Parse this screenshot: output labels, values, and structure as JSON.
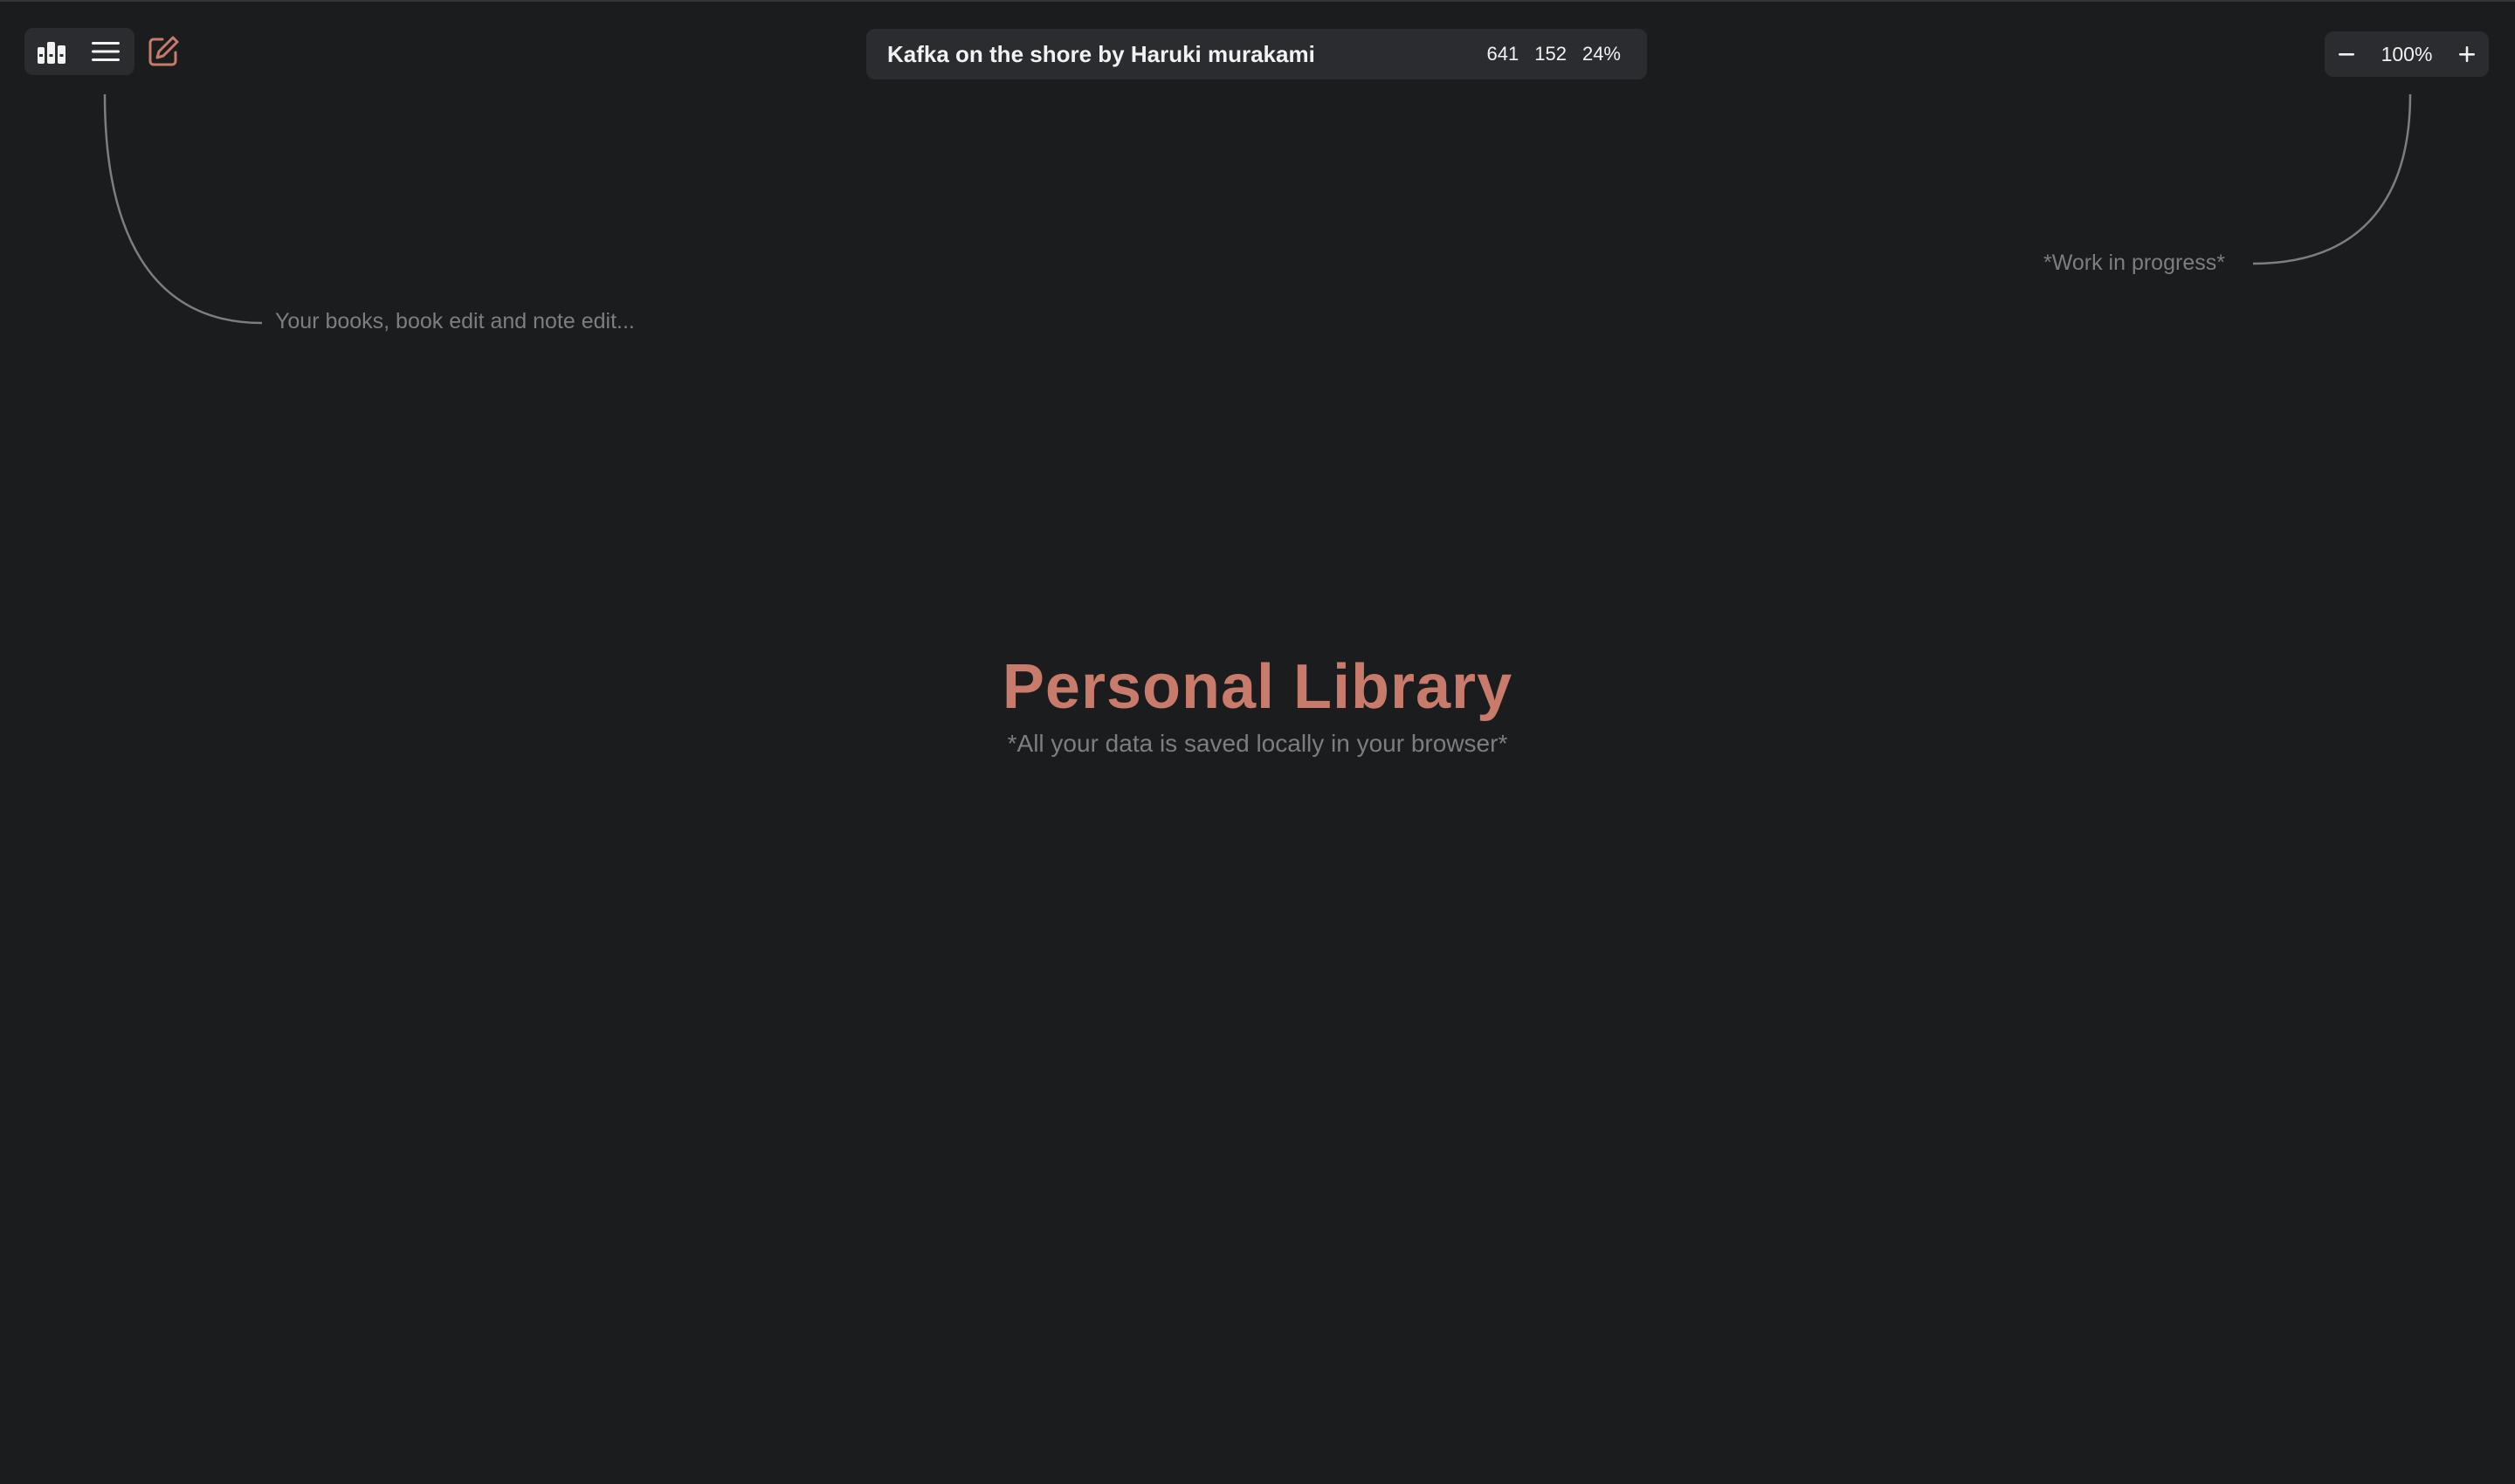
{
  "toolbar": {
    "library_icon": "bookshelf-icon",
    "menu_icon": "hamburger-menu-icon",
    "edit_icon": "edit-note-icon"
  },
  "book_bar": {
    "title": "Kafka on the shore by Haruki murakami",
    "stat_total": "641",
    "stat_current": "152",
    "stat_percent": "24%"
  },
  "zoom": {
    "minus_icon": "minus-icon",
    "plus_icon": "plus-icon",
    "value": "100%"
  },
  "hints": {
    "left": "Your books, book edit and note edit...",
    "right": "*Work in progress*"
  },
  "hero": {
    "title": "Personal Library",
    "subtitle": "*All your data is saved locally in your browser*"
  },
  "colors": {
    "background": "#1b1c1e",
    "panel": "#2b2c30",
    "accent": "#c87a6b",
    "muted_text": "#7d7e82",
    "text": "#f2f2f2"
  }
}
